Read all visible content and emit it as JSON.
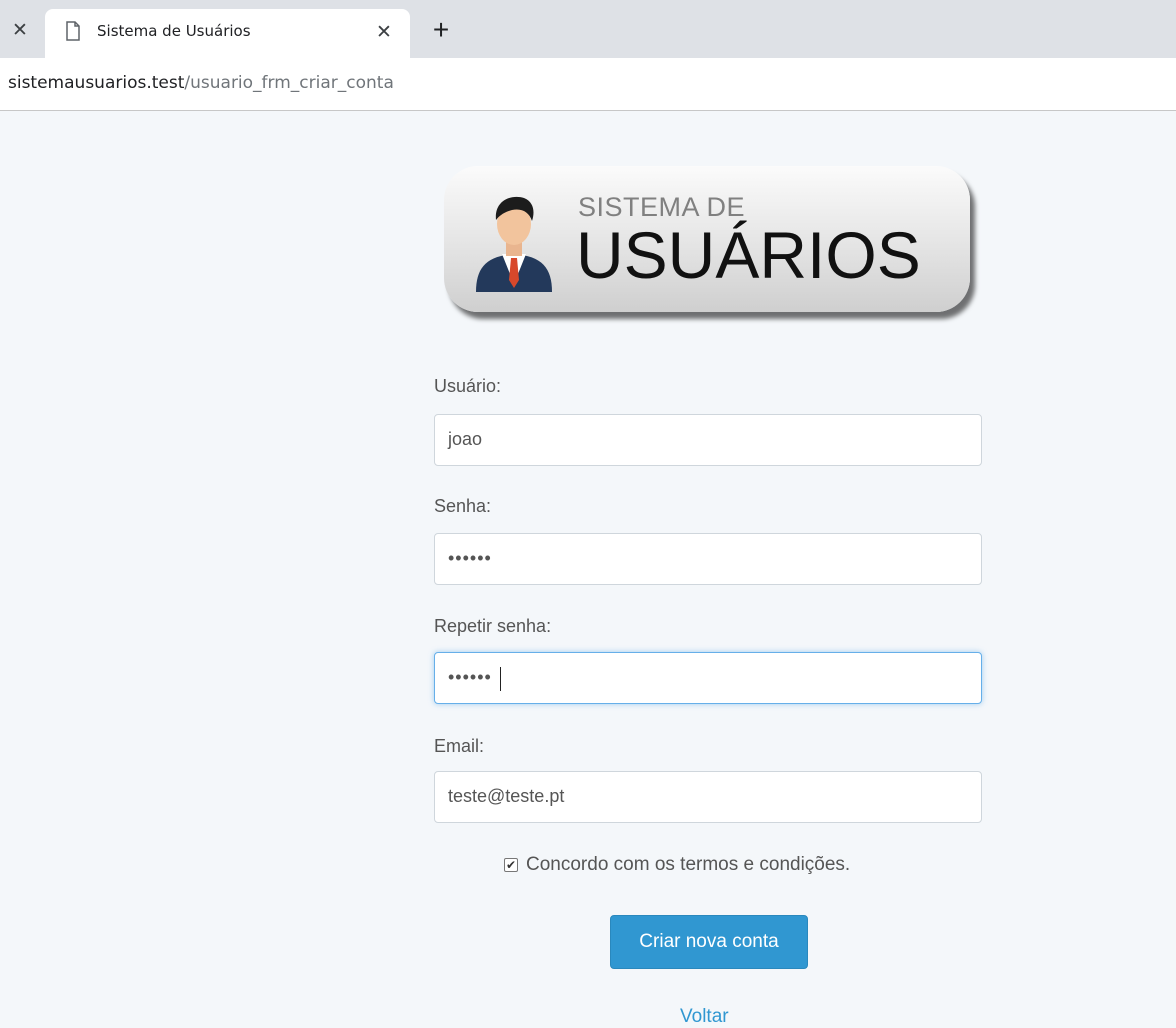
{
  "browser": {
    "tab_title": "Sistema de Usuários",
    "url_host": "sistemausuarios.test",
    "url_path": "/usuario_frm_criar_conta"
  },
  "logo": {
    "line1": "SISTEMA DE",
    "line2": "USUÁRIOS"
  },
  "form": {
    "user_label": "Usuário:",
    "user_value": "joao",
    "password_label": "Senha:",
    "password_value": "••••••",
    "repeat_label": "Repetir senha:",
    "repeat_value": "••••••",
    "email_label": "Email:",
    "email_value": "teste@teste.pt",
    "terms_checked": true,
    "terms_label": "Concordo com os termos e condições.",
    "submit_label": "Criar nova conta",
    "back_label": "Voltar"
  },
  "colors": {
    "primary": "#3097d1",
    "page_background": "#f4f7fa"
  }
}
